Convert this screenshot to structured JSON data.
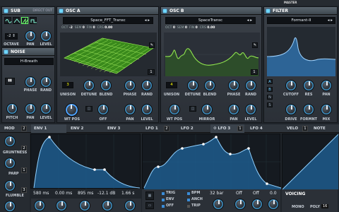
{
  "header": {
    "master_label": "MASTER"
  },
  "sub": {
    "title": "SUB",
    "direct_out": "DIRECT OUT",
    "octave_value": "-2",
    "labels": {
      "octave": "OCTAVE",
      "pan": "PAN",
      "level": "LEVEL"
    }
  },
  "noise": {
    "title": "NOISE",
    "preset": "H-Breath",
    "labels": {
      "pitch": "PITCH",
      "pan": "PAN",
      "level": "LEVEL",
      "phase": "PHASE",
      "rand": "RAND"
    }
  },
  "osc_a": {
    "title": "OSC A",
    "wavetable": "Space_FFT_Transc",
    "oct": "OCT",
    "oct_val": "-2",
    "sem": "SEM",
    "sem_val": "0",
    "fin": "FIN",
    "fin_val": "0",
    "crs": "CRS",
    "crs_val": "0.00",
    "frame": "1",
    "unison": "3",
    "labels": {
      "unison": "UNISON",
      "detune": "DETUNE",
      "blend": "BLEND",
      "phase": "PHASE",
      "rand": "RAND",
      "wt_pos": "WT POS",
      "off": "OFF",
      "pan": "PAN",
      "level": "LEVEL"
    }
  },
  "osc_b": {
    "title": "OSC B",
    "wavetable": "SpaceTransc",
    "oct": "OCT",
    "oct_val": "0",
    "sem": "SEM",
    "sem_val": "0",
    "fin": "FIN",
    "fin_val": "0",
    "crs": "CRS",
    "crs_val": "0.00",
    "frame": "1",
    "unison": "4",
    "labels": {
      "unison": "UNISON",
      "detune": "DETUNE",
      "blend": "BLEND",
      "phase": "PHASE",
      "rand": "RAND",
      "wt_pos": "WT POS",
      "mirror": "MIRROR",
      "pan": "PAN",
      "level": "LEVEL"
    }
  },
  "filter": {
    "title": "FILTER",
    "type": "Formant-II",
    "routing": [
      "A",
      "B",
      "N",
      "S"
    ],
    "labels": {
      "cutoff": "CUTOFF",
      "res": "RES",
      "pan": "PAN",
      "drive": "DRIVE",
      "formnt": "FORMNT",
      "mix": "MIX"
    }
  },
  "tabs": {
    "mod": "MOD",
    "mod_num": "2",
    "env1": "ENV 1",
    "env2": "ENV 2",
    "env3": "ENV 3",
    "lfo1": "LFO 1",
    "lfo1_num": "2",
    "lfo2": "LFO 2",
    "lfo3": "LFO 3",
    "lfo3_num": "1",
    "lfo4": "LFO 4",
    "velo": "VELO",
    "velo_num": "1",
    "note": "NOTE"
  },
  "sidebar": {
    "items": [
      {
        "label": "GRUNTNESS",
        "num": "2"
      },
      {
        "label": "PARP",
        "num": "1"
      },
      {
        "label": "FLUMBLE",
        "num": "3"
      }
    ]
  },
  "env_values": {
    "attack": "580 ms",
    "hold": "0.00 ms",
    "decay": "895 ms",
    "sustain": "-12.1 dB",
    "release": "1.66 s"
  },
  "lfo": {
    "trig": "TRIG",
    "env": "ENV",
    "off": "OFF",
    "bpm": "BPM",
    "anch": "ANCH",
    "trip": "TRIP",
    "rate": "32 bar",
    "rise": "Off",
    "delay": "Off",
    "smooth": "0.0"
  },
  "voicing": {
    "title": "VOICING",
    "mono": "MONO",
    "poly": "POLY",
    "poly_val": "16"
  },
  "colors": {
    "accent": "#3e93c7",
    "wave_green": "#7be83a",
    "filter_blue": "#2f6fa8"
  }
}
